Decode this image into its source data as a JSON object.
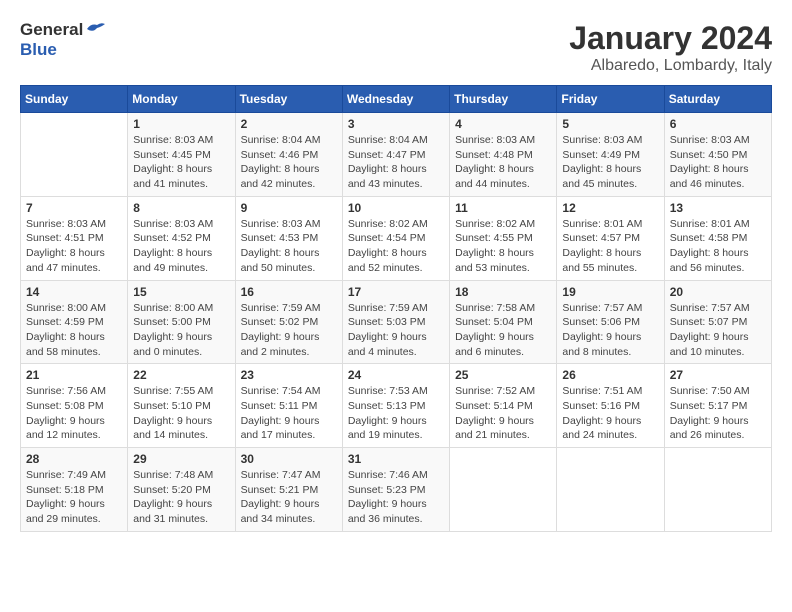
{
  "header": {
    "logo_general": "General",
    "logo_blue": "Blue",
    "month_title": "January 2024",
    "location": "Albaredo, Lombardy, Italy"
  },
  "weekdays": [
    "Sunday",
    "Monday",
    "Tuesday",
    "Wednesday",
    "Thursday",
    "Friday",
    "Saturday"
  ],
  "weeks": [
    [
      {
        "day": "",
        "info": ""
      },
      {
        "day": "1",
        "info": "Sunrise: 8:03 AM\nSunset: 4:45 PM\nDaylight: 8 hours\nand 41 minutes."
      },
      {
        "day": "2",
        "info": "Sunrise: 8:04 AM\nSunset: 4:46 PM\nDaylight: 8 hours\nand 42 minutes."
      },
      {
        "day": "3",
        "info": "Sunrise: 8:04 AM\nSunset: 4:47 PM\nDaylight: 8 hours\nand 43 minutes."
      },
      {
        "day": "4",
        "info": "Sunrise: 8:03 AM\nSunset: 4:48 PM\nDaylight: 8 hours\nand 44 minutes."
      },
      {
        "day": "5",
        "info": "Sunrise: 8:03 AM\nSunset: 4:49 PM\nDaylight: 8 hours\nand 45 minutes."
      },
      {
        "day": "6",
        "info": "Sunrise: 8:03 AM\nSunset: 4:50 PM\nDaylight: 8 hours\nand 46 minutes."
      }
    ],
    [
      {
        "day": "7",
        "info": "Sunrise: 8:03 AM\nSunset: 4:51 PM\nDaylight: 8 hours\nand 47 minutes."
      },
      {
        "day": "8",
        "info": "Sunrise: 8:03 AM\nSunset: 4:52 PM\nDaylight: 8 hours\nand 49 minutes."
      },
      {
        "day": "9",
        "info": "Sunrise: 8:03 AM\nSunset: 4:53 PM\nDaylight: 8 hours\nand 50 minutes."
      },
      {
        "day": "10",
        "info": "Sunrise: 8:02 AM\nSunset: 4:54 PM\nDaylight: 8 hours\nand 52 minutes."
      },
      {
        "day": "11",
        "info": "Sunrise: 8:02 AM\nSunset: 4:55 PM\nDaylight: 8 hours\nand 53 minutes."
      },
      {
        "day": "12",
        "info": "Sunrise: 8:01 AM\nSunset: 4:57 PM\nDaylight: 8 hours\nand 55 minutes."
      },
      {
        "day": "13",
        "info": "Sunrise: 8:01 AM\nSunset: 4:58 PM\nDaylight: 8 hours\nand 56 minutes."
      }
    ],
    [
      {
        "day": "14",
        "info": "Sunrise: 8:00 AM\nSunset: 4:59 PM\nDaylight: 8 hours\nand 58 minutes."
      },
      {
        "day": "15",
        "info": "Sunrise: 8:00 AM\nSunset: 5:00 PM\nDaylight: 9 hours\nand 0 minutes."
      },
      {
        "day": "16",
        "info": "Sunrise: 7:59 AM\nSunset: 5:02 PM\nDaylight: 9 hours\nand 2 minutes."
      },
      {
        "day": "17",
        "info": "Sunrise: 7:59 AM\nSunset: 5:03 PM\nDaylight: 9 hours\nand 4 minutes."
      },
      {
        "day": "18",
        "info": "Sunrise: 7:58 AM\nSunset: 5:04 PM\nDaylight: 9 hours\nand 6 minutes."
      },
      {
        "day": "19",
        "info": "Sunrise: 7:57 AM\nSunset: 5:06 PM\nDaylight: 9 hours\nand 8 minutes."
      },
      {
        "day": "20",
        "info": "Sunrise: 7:57 AM\nSunset: 5:07 PM\nDaylight: 9 hours\nand 10 minutes."
      }
    ],
    [
      {
        "day": "21",
        "info": "Sunrise: 7:56 AM\nSunset: 5:08 PM\nDaylight: 9 hours\nand 12 minutes."
      },
      {
        "day": "22",
        "info": "Sunrise: 7:55 AM\nSunset: 5:10 PM\nDaylight: 9 hours\nand 14 minutes."
      },
      {
        "day": "23",
        "info": "Sunrise: 7:54 AM\nSunset: 5:11 PM\nDaylight: 9 hours\nand 17 minutes."
      },
      {
        "day": "24",
        "info": "Sunrise: 7:53 AM\nSunset: 5:13 PM\nDaylight: 9 hours\nand 19 minutes."
      },
      {
        "day": "25",
        "info": "Sunrise: 7:52 AM\nSunset: 5:14 PM\nDaylight: 9 hours\nand 21 minutes."
      },
      {
        "day": "26",
        "info": "Sunrise: 7:51 AM\nSunset: 5:16 PM\nDaylight: 9 hours\nand 24 minutes."
      },
      {
        "day": "27",
        "info": "Sunrise: 7:50 AM\nSunset: 5:17 PM\nDaylight: 9 hours\nand 26 minutes."
      }
    ],
    [
      {
        "day": "28",
        "info": "Sunrise: 7:49 AM\nSunset: 5:18 PM\nDaylight: 9 hours\nand 29 minutes."
      },
      {
        "day": "29",
        "info": "Sunrise: 7:48 AM\nSunset: 5:20 PM\nDaylight: 9 hours\nand 31 minutes."
      },
      {
        "day": "30",
        "info": "Sunrise: 7:47 AM\nSunset: 5:21 PM\nDaylight: 9 hours\nand 34 minutes."
      },
      {
        "day": "31",
        "info": "Sunrise: 7:46 AM\nSunset: 5:23 PM\nDaylight: 9 hours\nand 36 minutes."
      },
      {
        "day": "",
        "info": ""
      },
      {
        "day": "",
        "info": ""
      },
      {
        "day": "",
        "info": ""
      }
    ]
  ]
}
